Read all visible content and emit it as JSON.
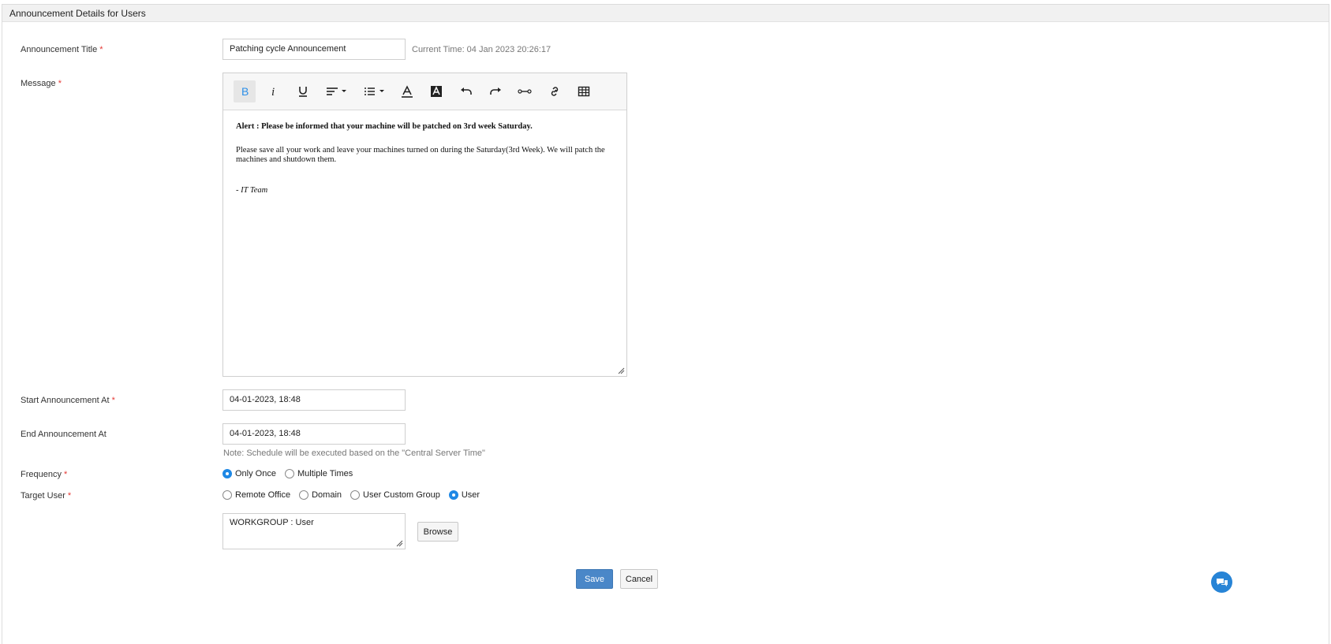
{
  "panel": {
    "header": "Announcement Details for Users"
  },
  "title_field": {
    "label": "Announcement Title",
    "required_mark": "*",
    "value": "Patching cycle Announcement",
    "current_time": "Current Time: 04 Jan 2023 20:26:17"
  },
  "message": {
    "label": "Message",
    "required_mark": "*",
    "toolbar": [
      {
        "name": "bold-icon",
        "glyph": "B",
        "active": true
      },
      {
        "name": "italic-icon",
        "glyph": "i"
      },
      {
        "name": "underline-icon",
        "glyph": "U"
      },
      {
        "name": "align-icon",
        "glyph": "≡",
        "dropdown": true
      },
      {
        "name": "list-icon",
        "glyph": "☰",
        "dropdown": true
      },
      {
        "name": "font-color-icon",
        "glyph": "A"
      },
      {
        "name": "background-color-icon",
        "glyph": "A"
      },
      {
        "name": "undo-icon",
        "glyph": "↶"
      },
      {
        "name": "redo-icon",
        "glyph": "↷"
      },
      {
        "name": "horizontal-rule-icon",
        "glyph": "⊶"
      },
      {
        "name": "link-icon",
        "glyph": "🔗"
      },
      {
        "name": "table-icon",
        "glyph": "▦"
      }
    ],
    "body": {
      "alert": "Alert : Please be informed that your machine will be patched on 3rd week Saturday.",
      "paragraph": "Please save all your work and leave your machines turned on during the Saturday(3rd Week). We will patch the machines and shutdown them.",
      "signature": "- IT Team"
    }
  },
  "start": {
    "label": "Start Announcement At",
    "required_mark": "*",
    "value": "04-01-2023, 18:48"
  },
  "end": {
    "label": "End Announcement At",
    "value": "04-01-2023, 18:48",
    "note": "Note: Schedule will be executed based on the \"Central Server Time\""
  },
  "frequency": {
    "label": "Frequency",
    "required_mark": "*",
    "options": [
      "Only Once",
      "Multiple Times"
    ],
    "selected": "Only Once"
  },
  "target_user": {
    "label": "Target User",
    "required_mark": "*",
    "options": [
      "Remote Office",
      "Domain",
      "User Custom Group",
      "User"
    ],
    "selected": "User",
    "value": "WORKGROUP : User",
    "browse_label": "Browse"
  },
  "actions": {
    "save_label": "Save",
    "cancel_label": "Cancel"
  },
  "colors": {
    "accent": "#1e88e5",
    "primary_button": "#4a87c8",
    "required": "#e53935"
  }
}
